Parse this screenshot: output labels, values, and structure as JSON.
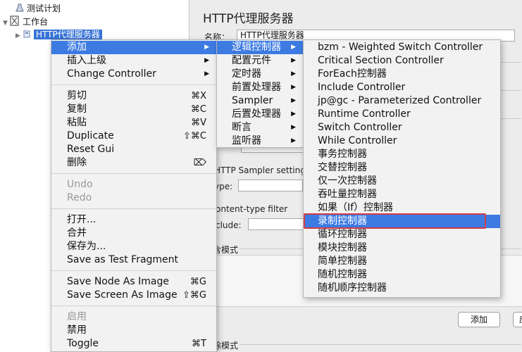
{
  "tree": {
    "items": [
      {
        "label": "测试计划"
      },
      {
        "label": "工作台"
      },
      {
        "label": "HTTP代理服务器"
      }
    ]
  },
  "panel": {
    "title": "HTTP代理服务器",
    "name_label": "名称：",
    "name_value": "HTTP代理服务器",
    "sampler_settings": "HTTP Sampler setting",
    "type_label": "ype:",
    "content_type_filter": "ontent-type filter",
    "include_label": "clude:",
    "include_mode": "含模式",
    "exclude_mode": "除模式",
    "add_button": "添加",
    "partial_label": "应"
  },
  "context_menu": {
    "items": [
      {
        "label": "添加",
        "arrow": "▶"
      },
      {
        "label": "插入上级",
        "arrow": "▶"
      },
      {
        "label": "Change Controller",
        "arrow": "▶"
      },
      {
        "label": "剪切",
        "shortcut": "⌘X"
      },
      {
        "label": "复制",
        "shortcut": "⌘C"
      },
      {
        "label": "粘贴",
        "shortcut": "⌘V"
      },
      {
        "label": "Duplicate",
        "shortcut": "⇧⌘C"
      },
      {
        "label": "Reset Gui"
      },
      {
        "label": "删除",
        "shortcut": "⌦"
      },
      {
        "label": "Undo"
      },
      {
        "label": "Redo"
      },
      {
        "label": "打开..."
      },
      {
        "label": "合并"
      },
      {
        "label": "保存为..."
      },
      {
        "label": "Save as Test Fragment"
      },
      {
        "label": "Save Node As Image",
        "shortcut": "⌘G"
      },
      {
        "label": "Save Screen As Image",
        "shortcut": "⇧⌘G"
      },
      {
        "label": "启用"
      },
      {
        "label": "禁用"
      },
      {
        "label": "Toggle",
        "shortcut": "⌘T"
      }
    ]
  },
  "add_submenu": {
    "items": [
      {
        "label": "逻辑控制器",
        "arrow": "▶"
      },
      {
        "label": "配置元件",
        "arrow": "▶"
      },
      {
        "label": "定时器",
        "arrow": "▶"
      },
      {
        "label": "前置处理器",
        "arrow": "▶"
      },
      {
        "label": "Sampler",
        "arrow": "▶"
      },
      {
        "label": "后置处理器",
        "arrow": "▶"
      },
      {
        "label": "断言",
        "arrow": "▶"
      },
      {
        "label": "监听器",
        "arrow": "▶"
      }
    ]
  },
  "logic_submenu": {
    "items": [
      {
        "label": "bzm - Weighted Switch Controller"
      },
      {
        "label": "Critical Section Controller"
      },
      {
        "label": "ForEach控制器"
      },
      {
        "label": "Include Controller"
      },
      {
        "label": "jp@gc - Parameterized Controller"
      },
      {
        "label": "Runtime Controller"
      },
      {
        "label": "Switch Controller"
      },
      {
        "label": "While Controller"
      },
      {
        "label": "事务控制器"
      },
      {
        "label": "交替控制器"
      },
      {
        "label": "仅一次控制器"
      },
      {
        "label": "吞吐量控制器"
      },
      {
        "label": "如果（If）控制器"
      },
      {
        "label": "录制控制器"
      },
      {
        "label": "循环控制器"
      },
      {
        "label": "模块控制器"
      },
      {
        "label": "简单控制器"
      },
      {
        "label": "随机控制器"
      },
      {
        "label": "随机顺序控制器"
      }
    ]
  },
  "colors": {
    "selection": "#3d7be3",
    "highlight_box": "#d23c47"
  }
}
